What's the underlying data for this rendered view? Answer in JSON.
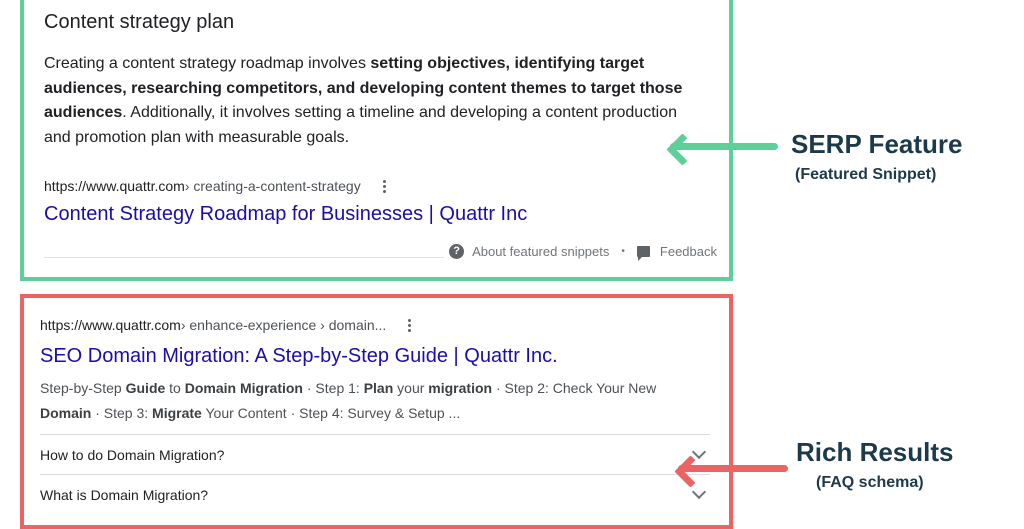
{
  "featured_snippet": {
    "heading": "Content strategy plan",
    "snippet_parts": [
      {
        "text": "Creating a content strategy roadmap involves ",
        "bold": false
      },
      {
        "text": "setting objectives, identifying target audiences, researching competitors, and developing content themes to target those audiences",
        "bold": true
      },
      {
        "text": ". Additionally, it involves setting a timeline and developing a content production and promotion plan with measurable goals.",
        "bold": false
      }
    ],
    "url_domain": "https://www.quattr.com",
    "url_path": " › creating-a-content-strategy",
    "title": "Content Strategy Roadmap for Businesses | Quattr Inc",
    "about_label": "About featured snippets",
    "separator": "•",
    "feedback_label": "Feedback"
  },
  "rich_result": {
    "url_domain": "https://www.quattr.com",
    "url_path": " › enhance-experience › domain...",
    "title": "SEO Domain Migration: A Step-by-Step Guide | Quattr Inc.",
    "desc_parts": [
      {
        "text": "Step-by-Step ",
        "bold": false
      },
      {
        "text": "Guide",
        "bold": true
      },
      {
        "text": " to ",
        "bold": false
      },
      {
        "text": "Domain Migration",
        "bold": true
      },
      {
        "text": " · Step 1: ",
        "bold": false
      },
      {
        "text": "Plan",
        "bold": true
      },
      {
        "text": " your ",
        "bold": false
      },
      {
        "text": "migration",
        "bold": true
      },
      {
        "text": " · Step 2: Check Your New ",
        "bold": false
      },
      {
        "text": "Domain",
        "bold": true
      },
      {
        "text": " · Step 3: ",
        "bold": false
      },
      {
        "text": "Migrate",
        "bold": true
      },
      {
        "text": " Your Content · Step 4: Survey & Setup ...",
        "bold": false
      }
    ],
    "faq": [
      {
        "question": "How to do Domain Migration?"
      },
      {
        "question": "What is Domain Migration?"
      }
    ]
  },
  "annotations": {
    "serp_title": "SERP Feature",
    "serp_sub": "(Featured Snippet)",
    "rich_title": "Rich Results",
    "rich_sub": "(FAQ schema)"
  },
  "colors": {
    "featured_border": "#5ecf97",
    "rich_border": "#ec6363",
    "link": "#1a0dab",
    "annotation_text": "#1d3a4a"
  },
  "icons": {
    "more": "kebab-menu-icon",
    "about": "question-circle-icon",
    "feedback": "feedback-icon",
    "faq_toggle": "chevron-down-icon",
    "pointer": "arrow-left-icon"
  }
}
